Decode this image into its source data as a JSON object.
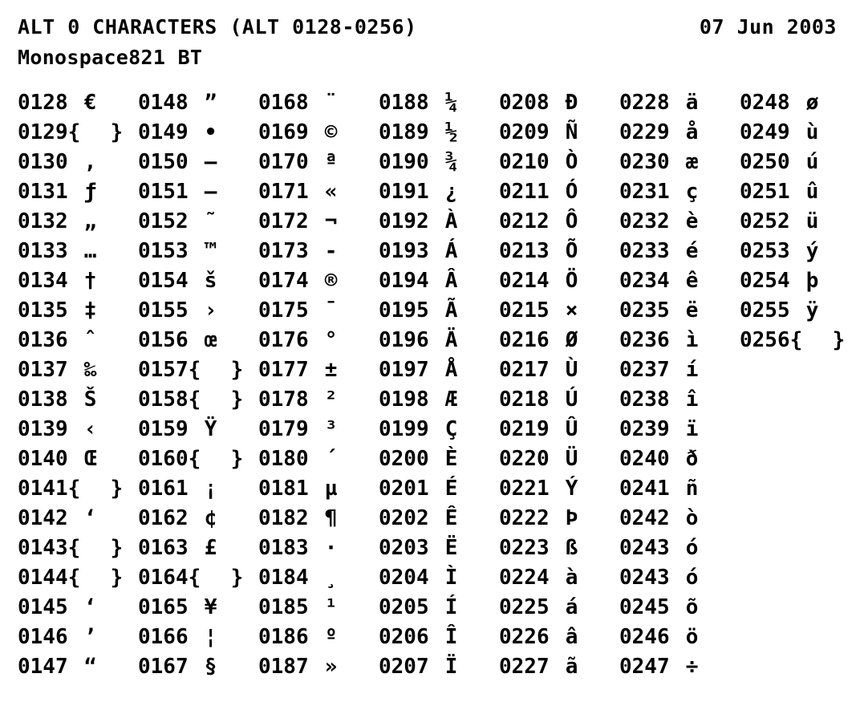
{
  "header": {
    "title": "ALT 0 CHARACTERS (ALT 0128-0256)",
    "date": "07 Jun 2003",
    "subtitle": "Monospace821 BT"
  },
  "table": {
    "placeholder_glyph": "{  }",
    "columns": [
      {
        "name": "column-1",
        "rows": [
          {
            "code": "0128",
            "glyph": "€",
            "placeholder": false
          },
          {
            "code": "0129",
            "glyph": "{  }",
            "placeholder": true
          },
          {
            "code": "0130",
            "glyph": "‚",
            "placeholder": false
          },
          {
            "code": "0131",
            "glyph": "ƒ",
            "placeholder": false
          },
          {
            "code": "0132",
            "glyph": "„",
            "placeholder": false
          },
          {
            "code": "0133",
            "glyph": "…",
            "placeholder": false
          },
          {
            "code": "0134",
            "glyph": "†",
            "placeholder": false
          },
          {
            "code": "0135",
            "glyph": "‡",
            "placeholder": false
          },
          {
            "code": "0136",
            "glyph": "ˆ",
            "placeholder": false
          },
          {
            "code": "0137",
            "glyph": "‰",
            "placeholder": false
          },
          {
            "code": "0138",
            "glyph": "Š",
            "placeholder": false
          },
          {
            "code": "0139",
            "glyph": "‹",
            "placeholder": false
          },
          {
            "code": "0140",
            "glyph": "Œ",
            "placeholder": false
          },
          {
            "code": "0141",
            "glyph": "{  }",
            "placeholder": true
          },
          {
            "code": "0142",
            "glyph": "‘",
            "placeholder": false
          },
          {
            "code": "0143",
            "glyph": "{  }",
            "placeholder": true
          },
          {
            "code": "0144",
            "glyph": "{  }",
            "placeholder": true
          },
          {
            "code": "0145",
            "glyph": "‘",
            "placeholder": false
          },
          {
            "code": "0146",
            "glyph": "’",
            "placeholder": false
          },
          {
            "code": "0147",
            "glyph": "“",
            "placeholder": false
          }
        ]
      },
      {
        "name": "column-2",
        "rows": [
          {
            "code": "0148",
            "glyph": "”",
            "placeholder": false
          },
          {
            "code": "0149",
            "glyph": "•",
            "placeholder": false
          },
          {
            "code": "0150",
            "glyph": "–",
            "placeholder": false
          },
          {
            "code": "0151",
            "glyph": "—",
            "placeholder": false
          },
          {
            "code": "0152",
            "glyph": "˜",
            "placeholder": false
          },
          {
            "code": "0153",
            "glyph": "™",
            "placeholder": false
          },
          {
            "code": "0154",
            "glyph": "š",
            "placeholder": false
          },
          {
            "code": "0155",
            "glyph": "›",
            "placeholder": false
          },
          {
            "code": "0156",
            "glyph": "œ",
            "placeholder": false
          },
          {
            "code": "0157",
            "glyph": "{  }",
            "placeholder": true
          },
          {
            "code": "0158",
            "glyph": "{  }",
            "placeholder": true
          },
          {
            "code": "0159",
            "glyph": "Ÿ",
            "placeholder": false
          },
          {
            "code": "0160",
            "glyph": "{  }",
            "placeholder": true
          },
          {
            "code": "0161",
            "glyph": "¡",
            "placeholder": false
          },
          {
            "code": "0162",
            "glyph": "¢",
            "placeholder": false
          },
          {
            "code": "0163",
            "glyph": "£",
            "placeholder": false
          },
          {
            "code": "0164",
            "glyph": "{  }",
            "placeholder": true
          },
          {
            "code": "0165",
            "glyph": "¥",
            "placeholder": false
          },
          {
            "code": "0166",
            "glyph": "¦",
            "placeholder": false
          },
          {
            "code": "0167",
            "glyph": "§",
            "placeholder": false
          }
        ]
      },
      {
        "name": "column-3",
        "rows": [
          {
            "code": "0168",
            "glyph": "¨",
            "placeholder": false
          },
          {
            "code": "0169",
            "glyph": "©",
            "placeholder": false
          },
          {
            "code": "0170",
            "glyph": "ª",
            "placeholder": false
          },
          {
            "code": "0171",
            "glyph": "«",
            "placeholder": false
          },
          {
            "code": "0172",
            "glyph": "¬",
            "placeholder": false
          },
          {
            "code": "0173",
            "glyph": "-",
            "placeholder": false
          },
          {
            "code": "0174",
            "glyph": "®",
            "placeholder": false
          },
          {
            "code": "0175",
            "glyph": "¯",
            "placeholder": false
          },
          {
            "code": "0176",
            "glyph": "°",
            "placeholder": false
          },
          {
            "code": "0177",
            "glyph": "±",
            "placeholder": false
          },
          {
            "code": "0178",
            "glyph": "²",
            "placeholder": false
          },
          {
            "code": "0179",
            "glyph": "³",
            "placeholder": false
          },
          {
            "code": "0180",
            "glyph": "´",
            "placeholder": false
          },
          {
            "code": "0181",
            "glyph": "µ",
            "placeholder": false
          },
          {
            "code": "0182",
            "glyph": "¶",
            "placeholder": false
          },
          {
            "code": "0183",
            "glyph": "·",
            "placeholder": false
          },
          {
            "code": "0184",
            "glyph": "¸",
            "placeholder": false
          },
          {
            "code": "0185",
            "glyph": "¹",
            "placeholder": false
          },
          {
            "code": "0186",
            "glyph": "º",
            "placeholder": false
          },
          {
            "code": "0187",
            "glyph": "»",
            "placeholder": false
          }
        ]
      },
      {
        "name": "column-4",
        "rows": [
          {
            "code": "0188",
            "glyph": "¼",
            "placeholder": false
          },
          {
            "code": "0189",
            "glyph": "½",
            "placeholder": false
          },
          {
            "code": "0190",
            "glyph": "¾",
            "placeholder": false
          },
          {
            "code": "0191",
            "glyph": "¿",
            "placeholder": false
          },
          {
            "code": "0192",
            "glyph": "À",
            "placeholder": false
          },
          {
            "code": "0193",
            "glyph": "Á",
            "placeholder": false
          },
          {
            "code": "0194",
            "glyph": "Â",
            "placeholder": false
          },
          {
            "code": "0195",
            "glyph": "Ã",
            "placeholder": false
          },
          {
            "code": "0196",
            "glyph": "Ä",
            "placeholder": false
          },
          {
            "code": "0197",
            "glyph": "Å",
            "placeholder": false
          },
          {
            "code": "0198",
            "glyph": "Æ",
            "placeholder": false
          },
          {
            "code": "0199",
            "glyph": "Ç",
            "placeholder": false
          },
          {
            "code": "0200",
            "glyph": "È",
            "placeholder": false
          },
          {
            "code": "0201",
            "glyph": "É",
            "placeholder": false
          },
          {
            "code": "0202",
            "glyph": "Ê",
            "placeholder": false
          },
          {
            "code": "0203",
            "glyph": "Ë",
            "placeholder": false
          },
          {
            "code": "0204",
            "glyph": "Ì",
            "placeholder": false
          },
          {
            "code": "0205",
            "glyph": "Í",
            "placeholder": false
          },
          {
            "code": "0206",
            "glyph": "Î",
            "placeholder": false
          },
          {
            "code": "0207",
            "glyph": "Ï",
            "placeholder": false
          }
        ]
      },
      {
        "name": "column-5",
        "rows": [
          {
            "code": "0208",
            "glyph": "Ð",
            "placeholder": false
          },
          {
            "code": "0209",
            "glyph": "Ñ",
            "placeholder": false
          },
          {
            "code": "0210",
            "glyph": "Ò",
            "placeholder": false
          },
          {
            "code": "0211",
            "glyph": "Ó",
            "placeholder": false
          },
          {
            "code": "0212",
            "glyph": "Ô",
            "placeholder": false
          },
          {
            "code": "0213",
            "glyph": "Õ",
            "placeholder": false
          },
          {
            "code": "0214",
            "glyph": "Ö",
            "placeholder": false
          },
          {
            "code": "0215",
            "glyph": "×",
            "placeholder": false
          },
          {
            "code": "0216",
            "glyph": "Ø",
            "placeholder": false
          },
          {
            "code": "0217",
            "glyph": "Ù",
            "placeholder": false
          },
          {
            "code": "0218",
            "glyph": "Ú",
            "placeholder": false
          },
          {
            "code": "0219",
            "glyph": "Û",
            "placeholder": false
          },
          {
            "code": "0220",
            "glyph": "Ü",
            "placeholder": false
          },
          {
            "code": "0221",
            "glyph": "Ý",
            "placeholder": false
          },
          {
            "code": "0222",
            "glyph": "Þ",
            "placeholder": false
          },
          {
            "code": "0223",
            "glyph": "ß",
            "placeholder": false
          },
          {
            "code": "0224",
            "glyph": "à",
            "placeholder": false
          },
          {
            "code": "0225",
            "glyph": "á",
            "placeholder": false
          },
          {
            "code": "0226",
            "glyph": "â",
            "placeholder": false
          },
          {
            "code": "0227",
            "glyph": "ã",
            "placeholder": false
          }
        ]
      },
      {
        "name": "column-6",
        "rows": [
          {
            "code": "0228",
            "glyph": "ä",
            "placeholder": false
          },
          {
            "code": "0229",
            "glyph": "å",
            "placeholder": false
          },
          {
            "code": "0230",
            "glyph": "æ",
            "placeholder": false
          },
          {
            "code": "0231",
            "glyph": "ç",
            "placeholder": false
          },
          {
            "code": "0232",
            "glyph": "è",
            "placeholder": false
          },
          {
            "code": "0233",
            "glyph": "é",
            "placeholder": false
          },
          {
            "code": "0234",
            "glyph": "ê",
            "placeholder": false
          },
          {
            "code": "0235",
            "glyph": "ë",
            "placeholder": false
          },
          {
            "code": "0236",
            "glyph": "ì",
            "placeholder": false
          },
          {
            "code": "0237",
            "glyph": "í",
            "placeholder": false
          },
          {
            "code": "0238",
            "glyph": "î",
            "placeholder": false
          },
          {
            "code": "0239",
            "glyph": "ï",
            "placeholder": false
          },
          {
            "code": "0240",
            "glyph": "ð",
            "placeholder": false
          },
          {
            "code": "0241",
            "glyph": "ñ",
            "placeholder": false
          },
          {
            "code": "0242",
            "glyph": "ò",
            "placeholder": false
          },
          {
            "code": "0243",
            "glyph": "ó",
            "placeholder": false
          },
          {
            "code": "0243",
            "glyph": "ó",
            "placeholder": false
          },
          {
            "code": "0245",
            "glyph": "õ",
            "placeholder": false
          },
          {
            "code": "0246",
            "glyph": "ö",
            "placeholder": false
          },
          {
            "code": "0247",
            "glyph": "÷",
            "placeholder": false
          }
        ]
      },
      {
        "name": "column-7",
        "rows": [
          {
            "code": "0248",
            "glyph": "ø",
            "placeholder": false
          },
          {
            "code": "0249",
            "glyph": "ù",
            "placeholder": false
          },
          {
            "code": "0250",
            "glyph": "ú",
            "placeholder": false
          },
          {
            "code": "0251",
            "glyph": "û",
            "placeholder": false
          },
          {
            "code": "0252",
            "glyph": "ü",
            "placeholder": false
          },
          {
            "code": "0253",
            "glyph": "ý",
            "placeholder": false
          },
          {
            "code": "0254",
            "glyph": "þ",
            "placeholder": false
          },
          {
            "code": "0255",
            "glyph": "ÿ",
            "placeholder": false
          },
          {
            "code": "0256",
            "glyph": "{  }",
            "placeholder": true
          }
        ]
      }
    ]
  }
}
